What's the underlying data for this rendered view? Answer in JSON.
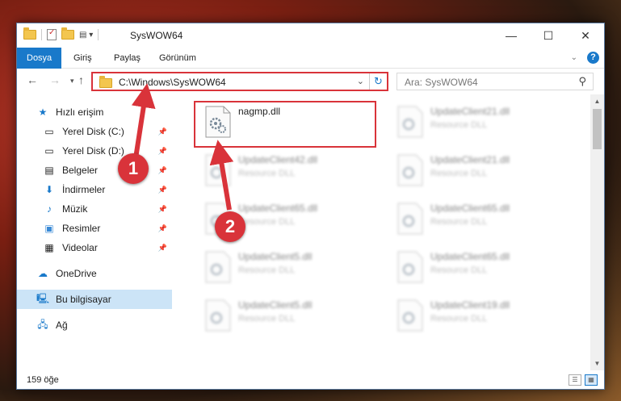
{
  "window": {
    "title": "SysWOW64"
  },
  "ribbon": {
    "tabs": [
      "Dosya",
      "Giriş",
      "Paylaş",
      "Görünüm"
    ]
  },
  "address": {
    "path": "C:\\Windows\\SysWOW64"
  },
  "search": {
    "placeholder": "Ara: SysWOW64"
  },
  "sidebar": {
    "items": [
      {
        "label": "Hızlı erişim"
      },
      {
        "label": "Yerel Disk (C:)"
      },
      {
        "label": "Yerel Disk (D:)"
      },
      {
        "label": "Belgeler"
      },
      {
        "label": "İndirmeler"
      },
      {
        "label": "Müzik"
      },
      {
        "label": "Resimler"
      },
      {
        "label": "Videolar"
      },
      {
        "label": "OneDrive"
      },
      {
        "label": "Bu bilgisayar"
      },
      {
        "label": "Ağ"
      }
    ]
  },
  "files": [
    {
      "name": "nagmp.dll",
      "type": ""
    },
    {
      "name": "UpdateClient21.dll",
      "type": "Resource DLL"
    },
    {
      "name": "UpdateClient42.dll",
      "type": "Resource DLL"
    },
    {
      "name": "UpdateClient21.dll",
      "type": "Resource DLL"
    },
    {
      "name": "UpdateClient65.dll",
      "type": "Resource DLL"
    },
    {
      "name": "UpdateClient65.dll",
      "type": "Resource DLL"
    },
    {
      "name": "UpdateClient5.dll",
      "type": "Resource DLL"
    },
    {
      "name": "UpdateClient65.dll",
      "type": "Resource DLL"
    },
    {
      "name": "UpdateClient5.dll",
      "type": "Resource DLL"
    },
    {
      "name": "UpdateClient19.dll",
      "type": "Resource DLL"
    }
  ],
  "status": {
    "item_count": "159 öğe"
  },
  "annotations": {
    "marker1": "1",
    "marker2": "2"
  },
  "colors": {
    "accent": "#1979ca",
    "highlight": "#d9333a"
  }
}
